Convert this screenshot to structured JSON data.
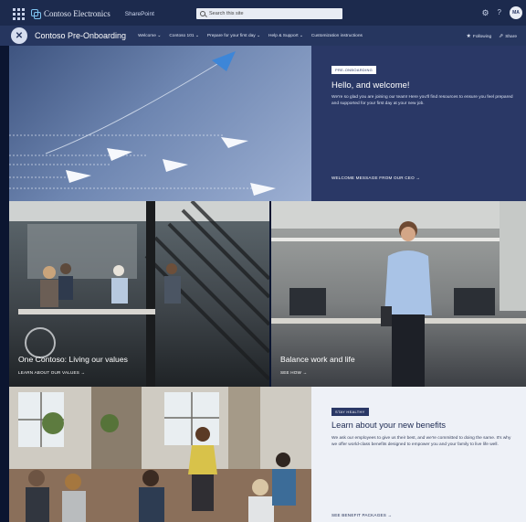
{
  "suite": {
    "brand": "Contoso Electronics",
    "app": "SharePoint",
    "search_placeholder": "Search this site",
    "avatar_initials": "MA"
  },
  "site": {
    "logo_glyph": "✕",
    "title": "Contoso Pre-Onboarding",
    "nav": [
      {
        "label": "Welcome ⌄"
      },
      {
        "label": "Contoso 101 ⌄"
      },
      {
        "label": "Prepare for your first day ⌄"
      },
      {
        "label": "Help & Support ⌄"
      },
      {
        "label": "Customization instructions"
      }
    ],
    "following": "Following",
    "share": "Share"
  },
  "hero": {
    "tag": "PRE-ONBOARDING",
    "heading": "Hello, and welcome!",
    "body": "We're so glad you are joining our team! Here you'll find resources to ensure you feel prepared and supported for your first day at your new job.",
    "link": "WELCOME MESSAGE FROM OUR CEO →"
  },
  "tiles": [
    {
      "title": "One Contoso: Living our values",
      "link": "LEARN ABOUT OUR VALUES →"
    },
    {
      "title": "Balance work and life",
      "link": "SEE HOW →"
    }
  ],
  "benefits": {
    "tag": "STAY HEALTHY",
    "heading": "Learn about your new benefits",
    "body": "We ask our employees to give us their best, and we're committed to doing the same. It's why we offer world-class benefits designed to empower you and your family to live life well.",
    "link": "SEE BENEFIT PACKAGES →"
  },
  "colors": {
    "suite_bar": "#1c2a4d",
    "site_bar": "#26365f",
    "panel_navy": "#2a3866",
    "panel_light": "#eef1f7"
  }
}
